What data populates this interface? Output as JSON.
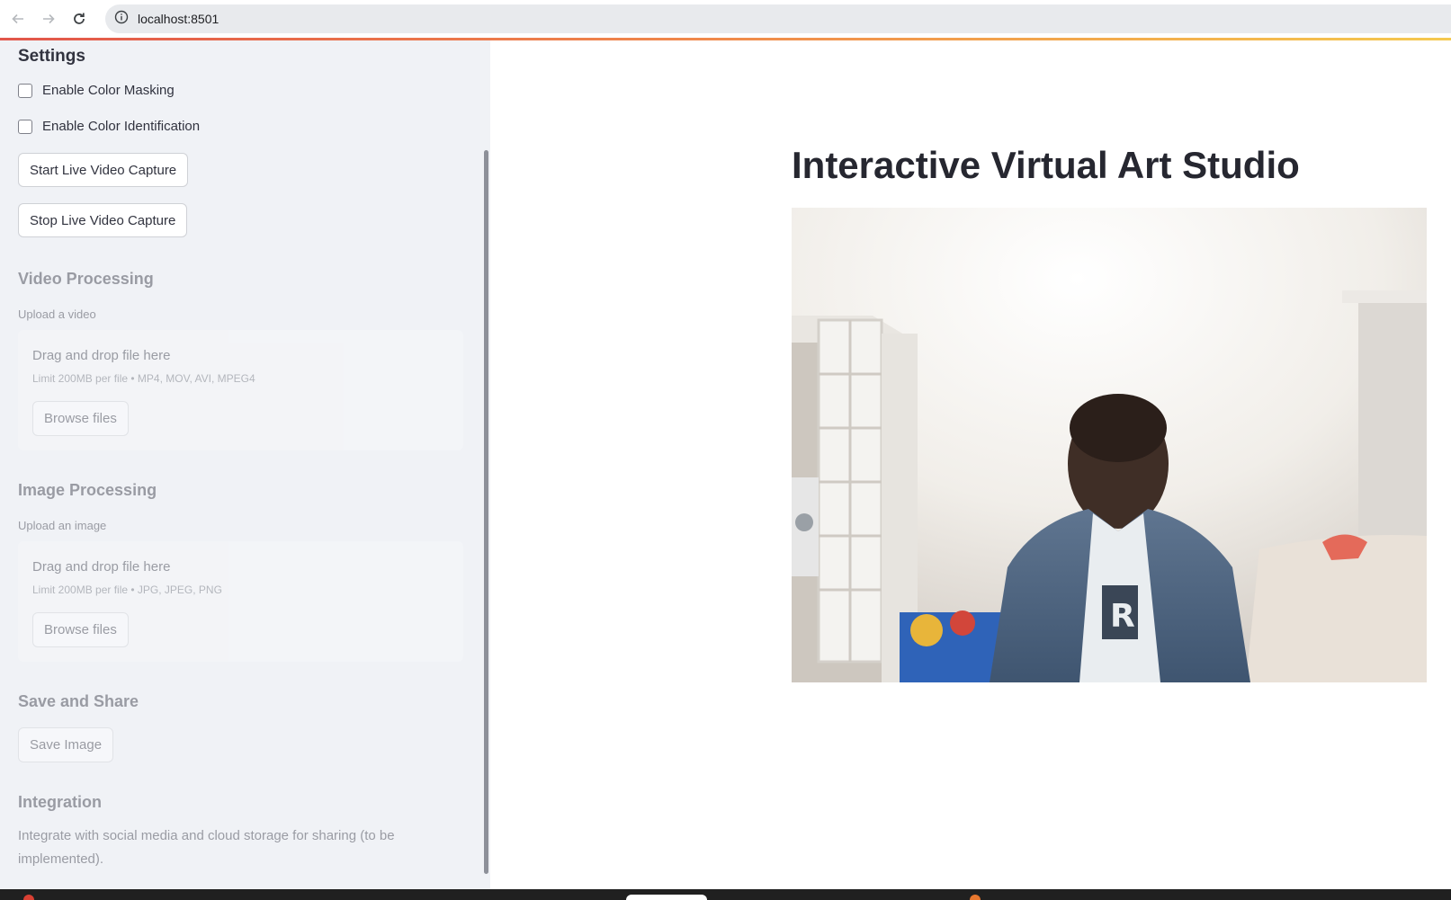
{
  "browser": {
    "url": "localhost:8501"
  },
  "sidebar": {
    "title": "Settings",
    "checkboxes": [
      {
        "label": "Enable Color Masking",
        "checked": false
      },
      {
        "label": "Enable Color Identification",
        "checked": false
      }
    ],
    "buttons": {
      "start_capture": "Start Live Video Capture",
      "stop_capture": "Stop Live Video Capture"
    },
    "video_processing": {
      "heading": "Video Processing",
      "upload_label": "Upload a video",
      "drop_text": "Drag and drop file here",
      "limit_text": "Limit 200MB per file • MP4, MOV, AVI, MPEG4",
      "browse_label": "Browse files"
    },
    "image_processing": {
      "heading": "Image Processing",
      "upload_label": "Upload an image",
      "drop_text": "Drag and drop file here",
      "limit_text": "Limit 200MB per file • JPG, JPEG, PNG",
      "browse_label": "Browse files"
    },
    "save_share": {
      "heading": "Save and Share",
      "save_label": "Save Image"
    },
    "integration": {
      "heading": "Integration",
      "text": "Integrate with social media and cloud storage for sharing (to be implemented)."
    }
  },
  "main": {
    "title": "Interactive Virtual Art Studio"
  },
  "colors": {
    "sidebar_bg": "#f0f2f6",
    "accent_start": "#e2564a",
    "accent_end": "#f5c94f",
    "text": "#31333f"
  }
}
